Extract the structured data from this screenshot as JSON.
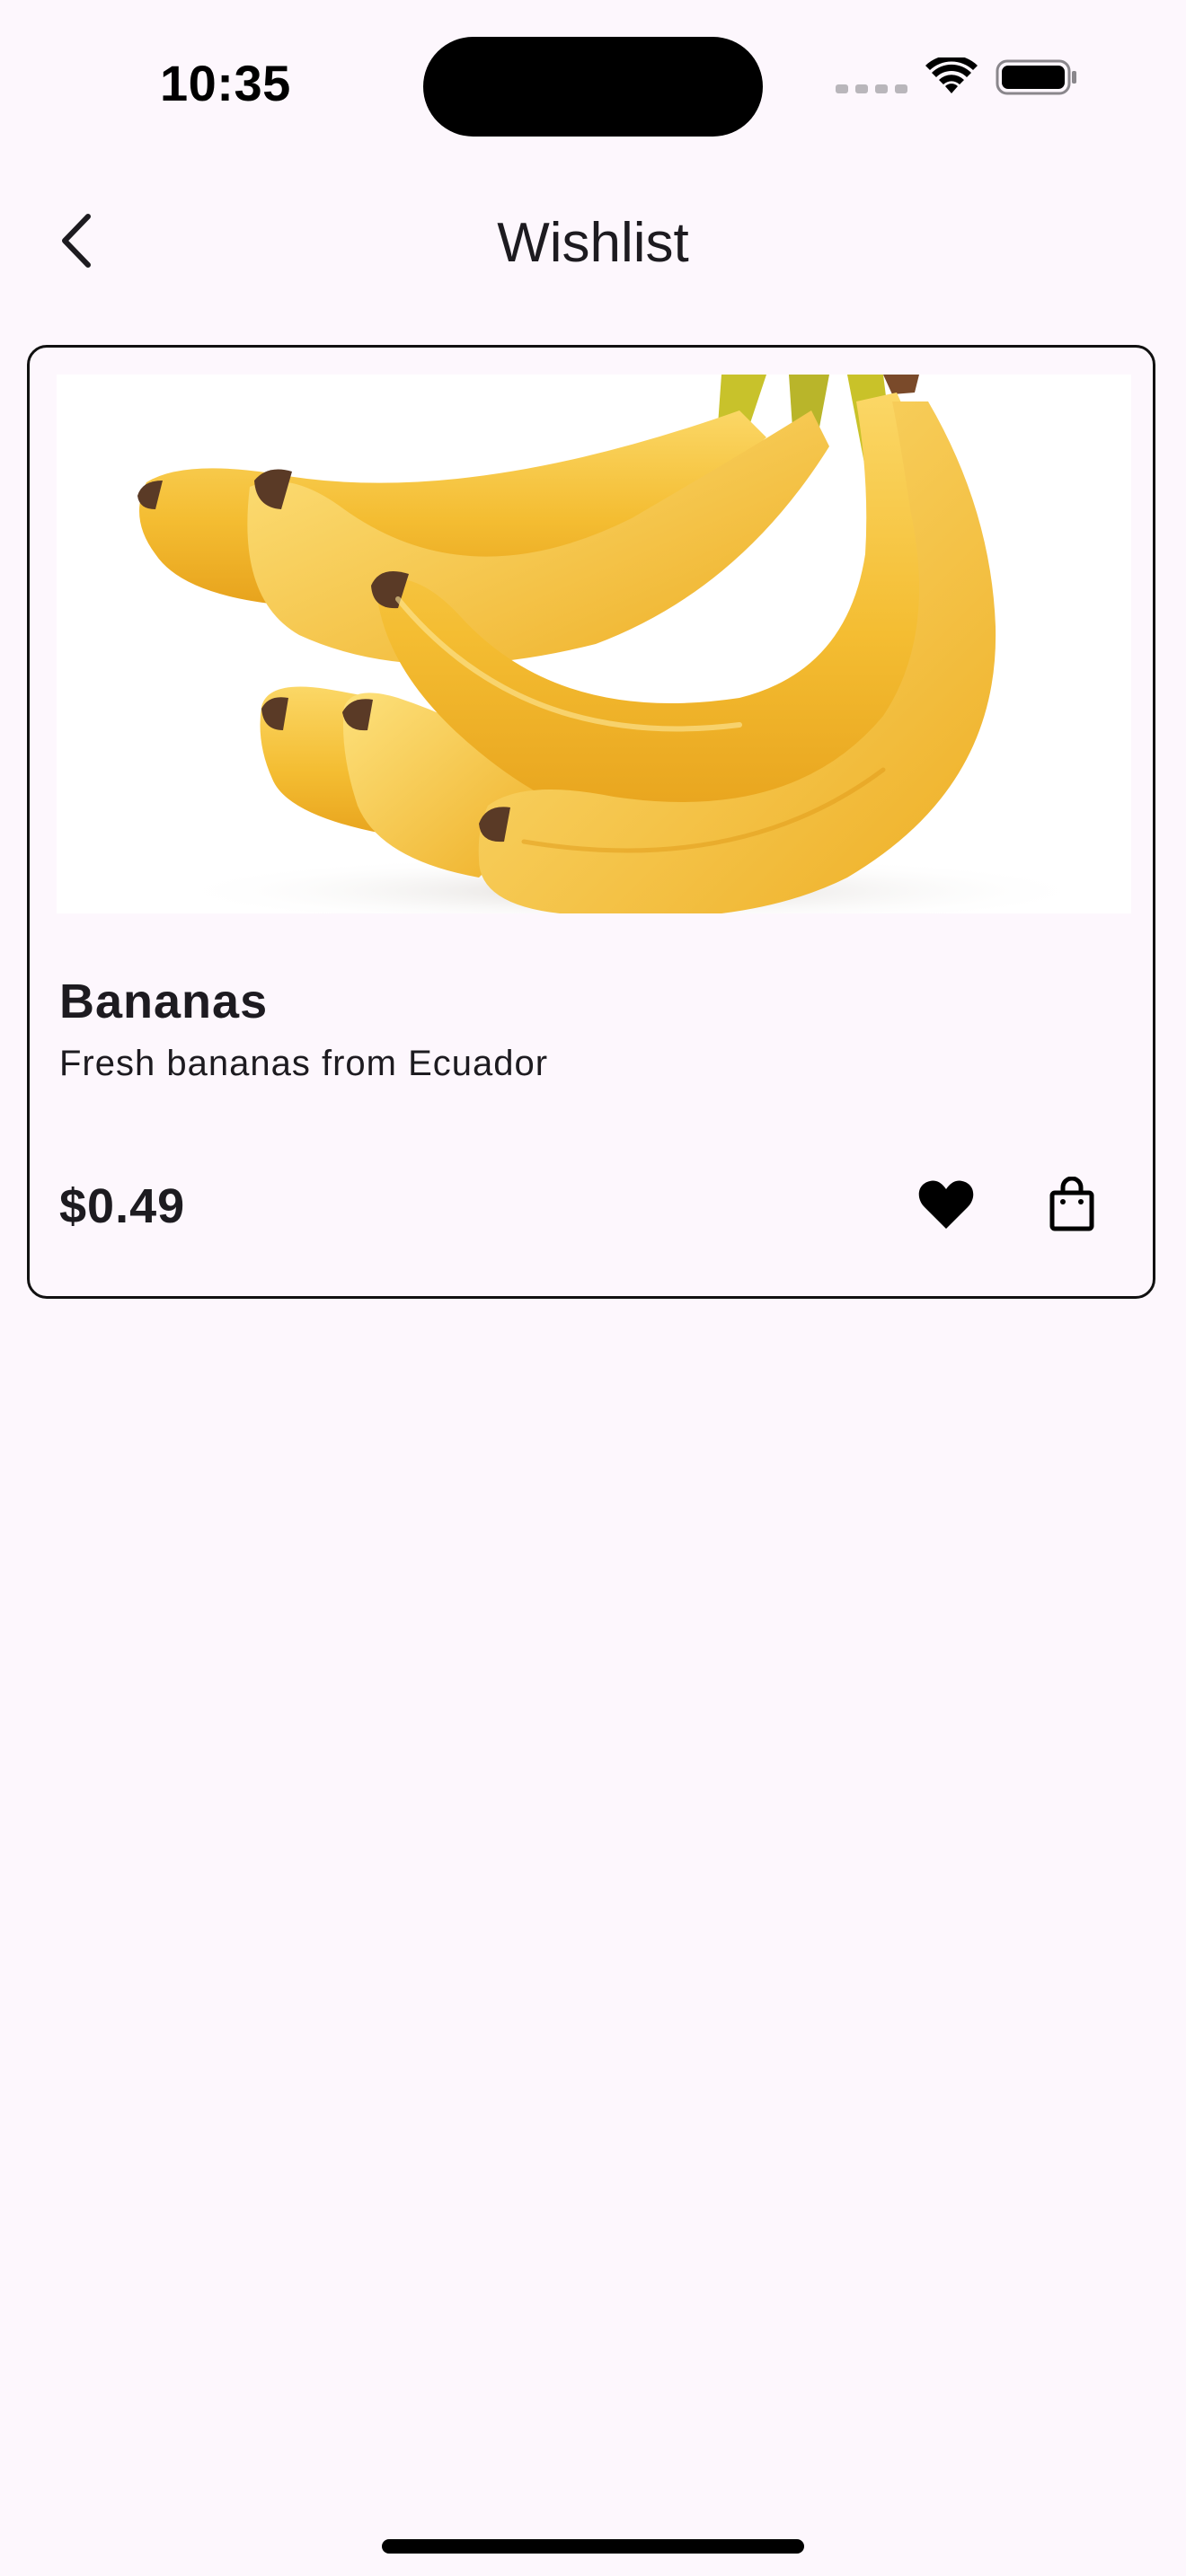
{
  "status_bar": {
    "time": "10:35"
  },
  "header": {
    "title": "Wishlist",
    "back_icon": "chevron-left-icon"
  },
  "wishlist": {
    "items": [
      {
        "name": "Bananas",
        "description": "Fresh bananas from Ecuador",
        "price": "$0.49",
        "image": "bananas-photo",
        "favorite_icon": "heart-filled-icon",
        "cart_icon": "shopping-bag-icon"
      }
    ]
  },
  "colors": {
    "background": "#fdf7fd",
    "text": "#1d1b20",
    "card_border": "#111111",
    "banana_yellow": "#f6c33b"
  }
}
